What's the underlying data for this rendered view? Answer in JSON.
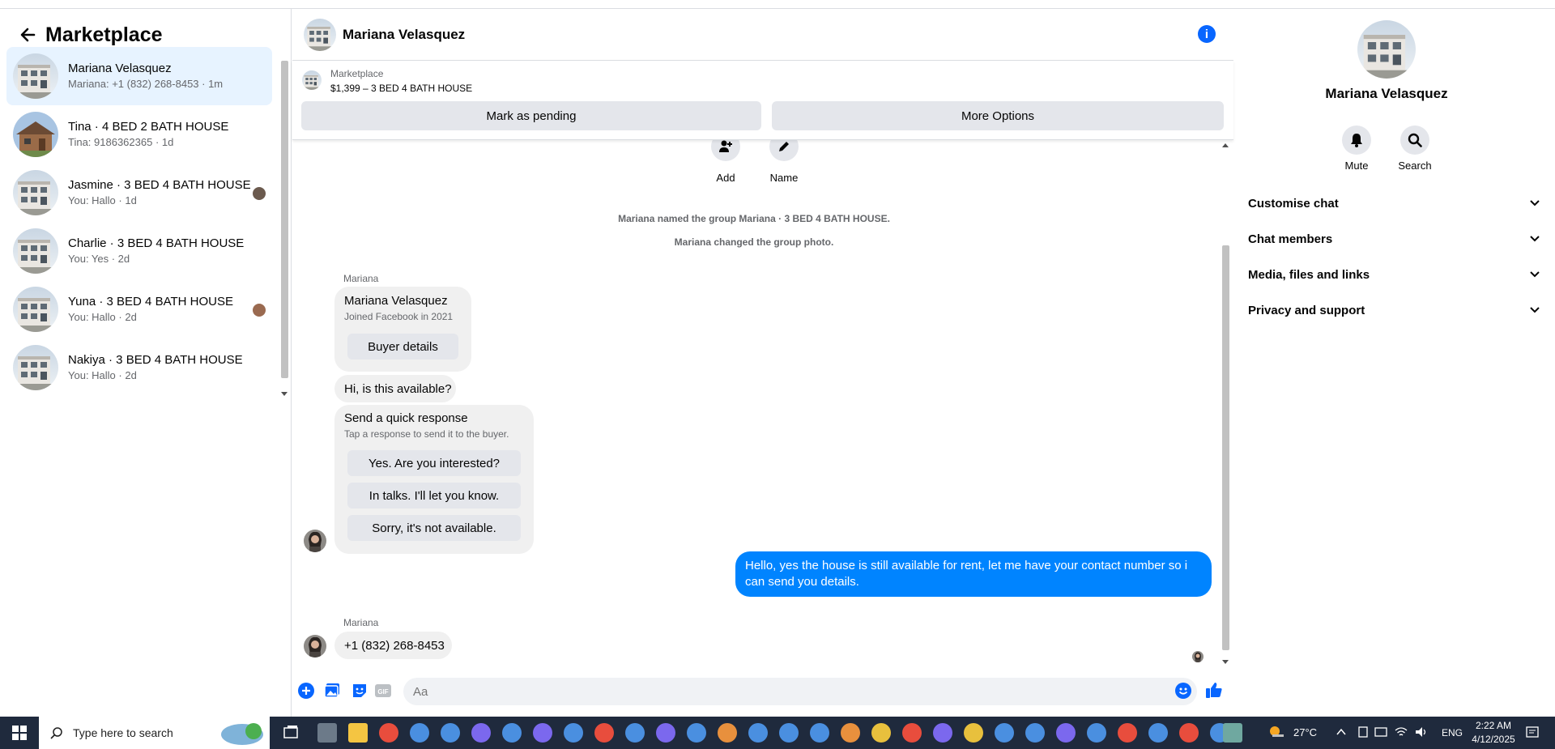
{
  "sidebar": {
    "title": "Marketplace",
    "conversations": [
      {
        "name": "Mariana Velasquez",
        "sub": "Mariana: +1 (832) 268-8453 · 1m",
        "active": true
      },
      {
        "name": "Tina · 4 BED 2 BATH HOUSE",
        "sub": "Tina: 9186362365 · 1d"
      },
      {
        "name": "Jasmine · 3 BED 4 BATH HOUSE",
        "sub": "You: Hallo · 1d"
      },
      {
        "name": "Charlie · 3 BED 4 BATH HOUSE",
        "sub": "You: Yes · 2d"
      },
      {
        "name": "Yuna · 3 BED 4 BATH HOUSE",
        "sub": "You: Hallo · 2d"
      },
      {
        "name": "Nakiya · 3 BED 4 BATH HOUSE",
        "sub": "You: Hallo · 2d"
      }
    ]
  },
  "chat": {
    "title": "Mariana Velasquez",
    "listing": {
      "label": "Marketplace",
      "price_title": "$1,399 – 3 BED 4 BATH HOUSE",
      "pending_button": "Mark as pending",
      "more_button": "More Options"
    },
    "actions": {
      "add": "Add",
      "name": "Name"
    },
    "system": {
      "renamed": "Mariana named the group Mariana · 3 BED 4 BATH HOUSE.",
      "photo": "Mariana changed the group photo."
    },
    "sender": "Mariana",
    "profile_card": {
      "name": "Mariana Velasquez",
      "joined": "Joined Facebook in 2021",
      "button": "Buyer details"
    },
    "incoming_1": "Hi, is this available?",
    "quick_response": {
      "title": "Send a quick response",
      "subtitle": "Tap a response to send it to the buyer.",
      "options": [
        "Yes. Are you interested?",
        "In talks. I'll let you know.",
        "Sorry, it's not available."
      ]
    },
    "outgoing": "Hello, yes the house is still available for rent, let me have your contact number so i can send you details.",
    "sender_2": "Mariana",
    "incoming_2": "+1 (832) 268-8453",
    "composer_placeholder": "Aa"
  },
  "right_panel": {
    "name": "Mariana Velasquez",
    "mute": "Mute",
    "search": "Search",
    "sections": [
      "Customise chat",
      "Chat members",
      "Media, files and links",
      "Privacy and support"
    ]
  },
  "taskbar": {
    "search_placeholder": "Type here to search",
    "temperature": "27°C",
    "language": "ENG",
    "time": "2:22 AM",
    "date": "4/12/2025"
  },
  "colors": {
    "accent": "#0866ff",
    "bubble_blue": "#0084ff",
    "active_row": "#e7f3ff"
  }
}
